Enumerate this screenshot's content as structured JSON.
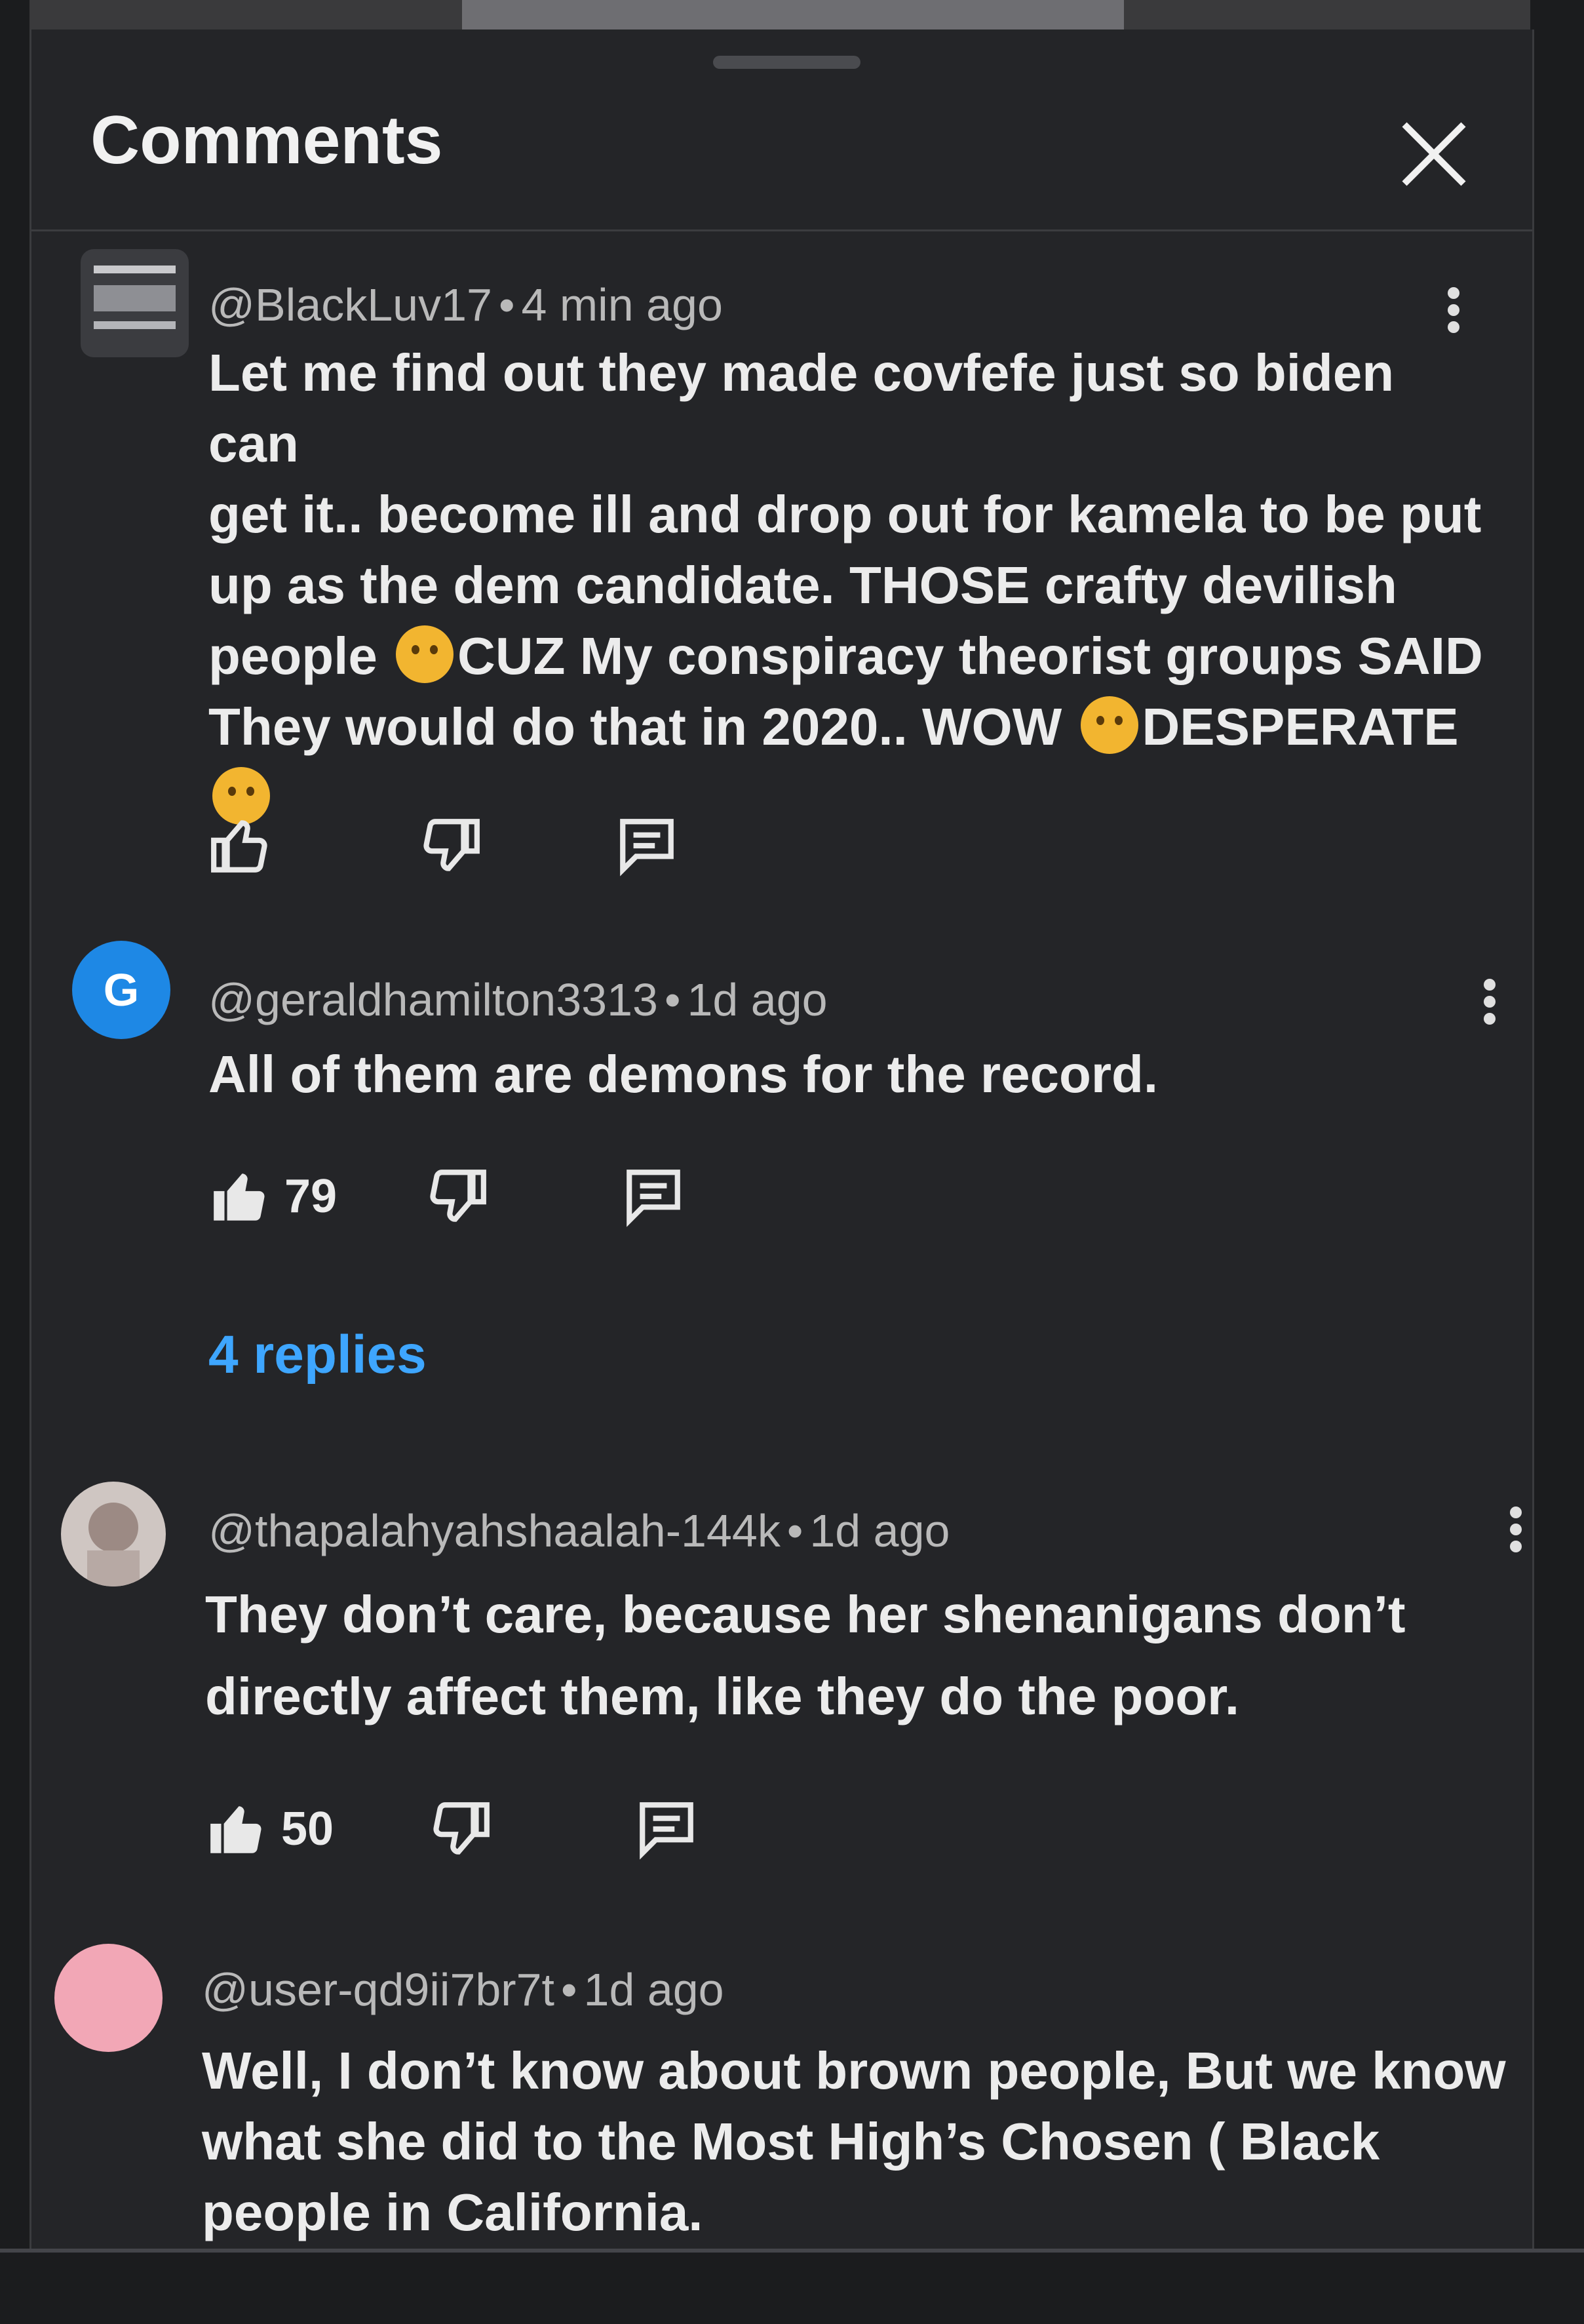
{
  "panel": {
    "title": "Comments"
  },
  "comments": [
    {
      "handle": "@BlackLuv17",
      "time": "4 min ago",
      "lines": [
        "Let me find out they made covfefe just so biden can",
        "get it.. become ill and drop out for kamela to be put",
        "up as the dem candidate. THOSE crafty devilish",
        [
          "people ",
          "CUZ My conspiracy theorist groups SAID"
        ],
        [
          "They would do that in 2020.. WOW ",
          "DESPERATE"
        ]
      ],
      "emoji_after_text": "laughing-emoji",
      "likes": ""
    },
    {
      "handle": "@geraldhamilton3313",
      "time": "1d ago",
      "avatar_letter": "G",
      "text": "All of them are demons for the record.",
      "likes": "79",
      "replies_label": "4 replies"
    },
    {
      "handle": "@thapalahyahshaalah-144k",
      "time": "1d ago",
      "line1": "They don’t care, because her shenanigans don’t",
      "line2": "directly affect them, like they do the poor.",
      "likes": "50"
    },
    {
      "handle": "@user-qd9ii7br7t",
      "time": "1d ago",
      "line1": "Well, I don’t know about brown people, But we know",
      "line2": "what she did to the Most High’s Chosen ( Black",
      "line3": "people in California."
    }
  ],
  "colors": {
    "background": "#242528",
    "accent_link": "#3ea6ff",
    "avatar_blue": "#1e88e5",
    "avatar_pink": "#f2a7b6"
  },
  "icons": [
    "close-icon",
    "kebab-menu-icon",
    "thumbs-up-icon",
    "thumbs-down-icon",
    "reply-icon"
  ]
}
